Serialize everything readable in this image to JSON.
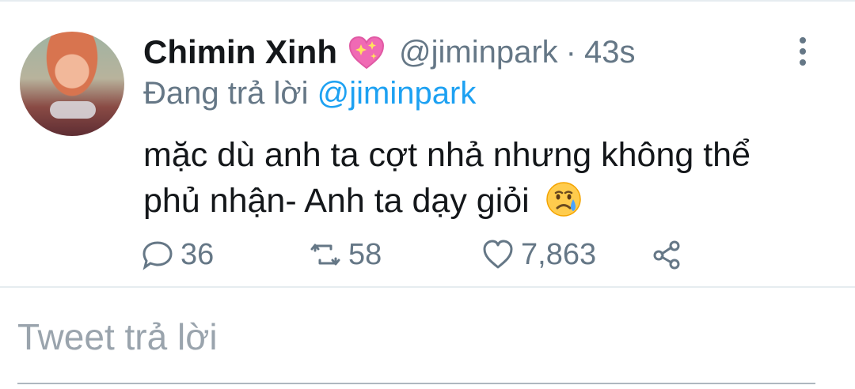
{
  "tweet": {
    "display_name": "Chimin Xinh",
    "name_emoji": "sparkling-heart",
    "handle": "@jiminpark",
    "separator": "·",
    "time": "43s",
    "reply_prefix": "Đang trả lời",
    "reply_handle": "@jiminpark",
    "text_line_1": "mặc dù anh ta cợt nhả nhưng không thể",
    "text_line_2": "phủ nhận- Anh ta dạy giỏi",
    "text_emoji": "crying-face"
  },
  "actions": {
    "replies": "36",
    "retweets": "58",
    "likes": "7,863"
  },
  "reply_box": {
    "placeholder": "Tweet trả lời"
  },
  "icons": {
    "reply": "reply-icon",
    "retweet": "retweet-icon",
    "like": "heart-icon",
    "share": "share-icon",
    "more": "more-vertical-icon"
  },
  "colors": {
    "text": "#14171a",
    "secondary": "#657786",
    "accent": "#1da1f2",
    "border": "#e6ecf0"
  }
}
